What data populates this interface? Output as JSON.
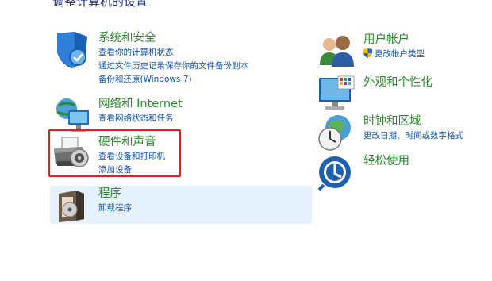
{
  "page": {
    "heading": "调整计算机的设置"
  },
  "left_column": [
    {
      "title": "系统和安全",
      "links": [
        "查看你的计算机状态",
        "通过文件历史记录保存你的文件备份副本",
        "备份和还原(Windows 7)"
      ]
    },
    {
      "title": "网络和 Internet",
      "links": [
        "查看网络状态和任务"
      ]
    },
    {
      "title": "硬件和声音",
      "links": [
        "查看设备和打印机",
        "添加设备"
      ]
    },
    {
      "title": "程序",
      "links": [
        "卸载程序"
      ]
    }
  ],
  "right_column": [
    {
      "title": "用户帐户",
      "links": [
        "更改帐户类型"
      ]
    },
    {
      "title": "外观和个性化",
      "links": []
    },
    {
      "title": "时钟和区域",
      "links": [
        "更改日期、时间或数字格式"
      ]
    },
    {
      "title": "轻松使用",
      "links": []
    }
  ],
  "colors": {
    "title_green": "#2a8a2a",
    "link_blue": "#0b4fb5",
    "highlight_red": "#e02020",
    "hover_bg": "#e5f1fb"
  },
  "icons": [
    "shield-icon",
    "network-icon",
    "printer-icon",
    "programs-icon",
    "users-icon",
    "monitor-icon",
    "clock-globe-icon",
    "ease-of-access-icon"
  ]
}
